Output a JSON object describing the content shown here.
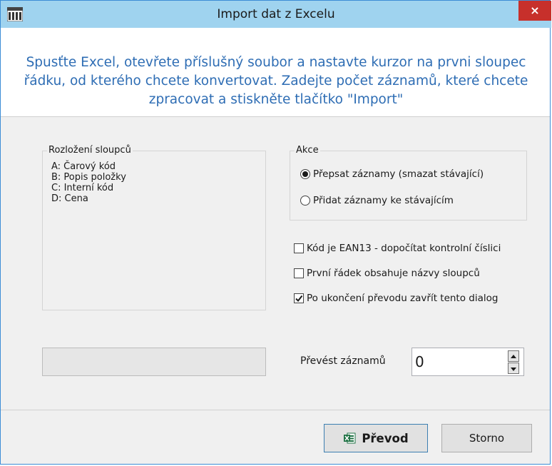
{
  "window": {
    "title": "Import dat z Excelu",
    "close_label": "×"
  },
  "banner": {
    "instructions": "Spusťte Excel, otevřete příslušný soubor a nastavte kurzor na prvni sloupec řádku, od kterého chcete konvertovat. Zadejte počet záznamů, které chcete zpracovat a stiskněte tlačítko \"Import\""
  },
  "columns_group": {
    "legend": "Rozložení sloupců",
    "lines": [
      "A: Čarový kód",
      "B: Popis položky",
      "C: Interní kód",
      "D: Cena"
    ]
  },
  "action_group": {
    "legend": "Akce",
    "options": [
      {
        "label": "Přepsat záznamy (smazat stávající)",
        "selected": true
      },
      {
        "label": "Přidat záznamy ke stávajícím",
        "selected": false
      }
    ]
  },
  "options": [
    {
      "label": "Kód je EAN13 - dopočítat kontrolní číslici",
      "checked": false
    },
    {
      "label": "První řádek obsahuje názvy sloupců",
      "checked": false
    },
    {
      "label": "Po ukončení převodu zavřít tento dialog",
      "checked": true
    }
  ],
  "progress": {
    "value": 0
  },
  "count": {
    "label": "Převést záznamů",
    "value": "0"
  },
  "buttons": {
    "convert": "Převod",
    "cancel": "Storno"
  },
  "colors": {
    "titlebar": "#9fd3ef",
    "close": "#c7302b",
    "instruction_text": "#2e6db4",
    "dialog_bg": "#f0f0f0"
  }
}
